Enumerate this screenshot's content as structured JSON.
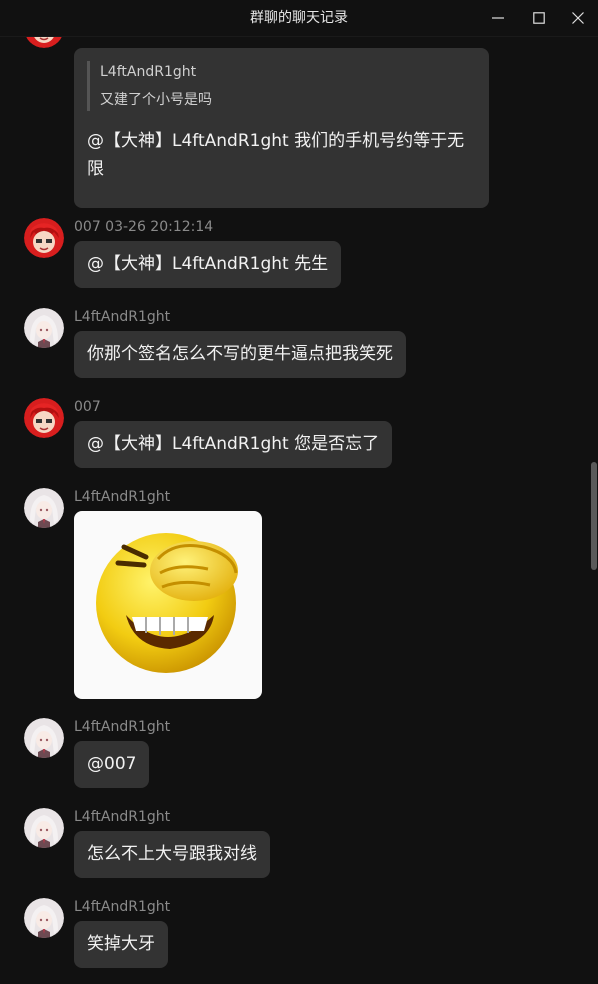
{
  "window": {
    "title": "群聊的聊天记录"
  },
  "messages": [
    {
      "quote_name": "L4ftAndR1ght",
      "quote_text": "又建了个小号是吗",
      "text": "@【大神】L4ftAndR1ght 我们的手机号约等于无限",
      "avatar": "red-hair-avatar"
    },
    {
      "meta": "007 03-26 20:12:14",
      "text": "@【大神】L4ftAndR1ght 先生",
      "avatar": "red-hair-avatar"
    },
    {
      "meta": "L4ftAndR1ght",
      "text": "你那个签名怎么不写的更牛逼点把我笑死",
      "avatar": "white-hair-avatar"
    },
    {
      "meta": "007",
      "text": "@【大神】L4ftAndR1ght 您是否忘了",
      "avatar": "red-hair-avatar"
    },
    {
      "meta": "L4ftAndR1ght",
      "image": "laughing-emoji",
      "avatar": "white-hair-avatar"
    },
    {
      "meta": "L4ftAndR1ght",
      "text": "@007",
      "avatar": "white-hair-avatar"
    },
    {
      "meta": "L4ftAndR1ght",
      "text": "怎么不上大号跟我对线",
      "avatar": "white-hair-avatar"
    },
    {
      "meta": "L4ftAndR1ght",
      "text": "笑掉大牙",
      "avatar": "white-hair-avatar"
    }
  ],
  "colors": {
    "background": "#111111",
    "bubble": "#333333",
    "meta_text": "#8a8a8a",
    "bubble_text": "#f2f2f2"
  },
  "icons": {
    "minimize": "minimize-icon",
    "maximize": "maximize-icon",
    "close": "close-icon"
  }
}
